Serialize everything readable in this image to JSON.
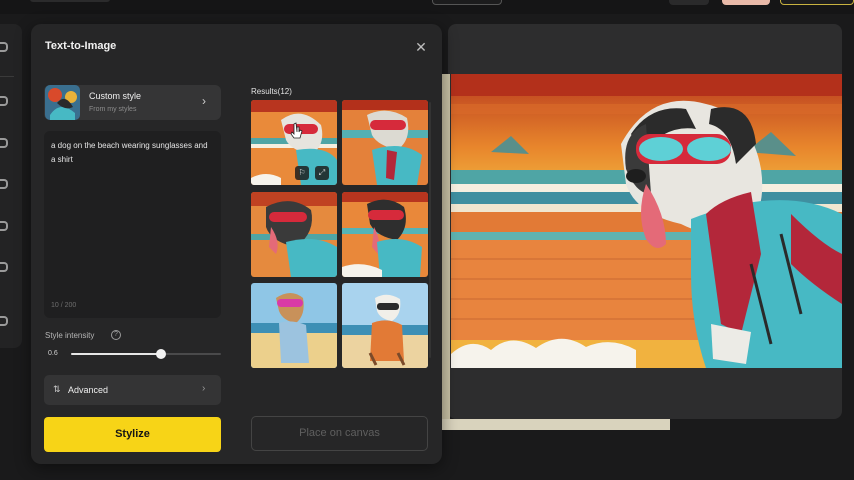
{
  "dialog": {
    "title": "Text-to-Image",
    "close_icon": "close-icon"
  },
  "style": {
    "name": "Custom style",
    "subtitle": "From my styles",
    "chevron_icon": "chevron-right-icon"
  },
  "prompt": {
    "text": "a dog on the beach wearing sunglasses and a shirt",
    "count": "10 / 200"
  },
  "intensity": {
    "label": "Style intensity",
    "info_icon": "info-icon",
    "value": "0.6",
    "level": 0.6
  },
  "advanced": {
    "label": "Advanced",
    "icon": "sliders-icon",
    "chevron_icon": "chevron-right-icon"
  },
  "actions": {
    "stylize_label": "Stylize",
    "place_label": "Place on canvas"
  },
  "results": {
    "label": "Results(12)",
    "items": [
      {
        "palette": "orange-cyan-red"
      },
      {
        "palette": "orange-cyan-red"
      },
      {
        "palette": "orange-cyan-red"
      },
      {
        "palette": "orange-cyan-red"
      },
      {
        "palette": "beach-blue"
      },
      {
        "palette": "beach-blue"
      }
    ]
  },
  "colors": {
    "accent": "#f7d417",
    "panel": "#262627",
    "background": "#1a1a1b"
  }
}
